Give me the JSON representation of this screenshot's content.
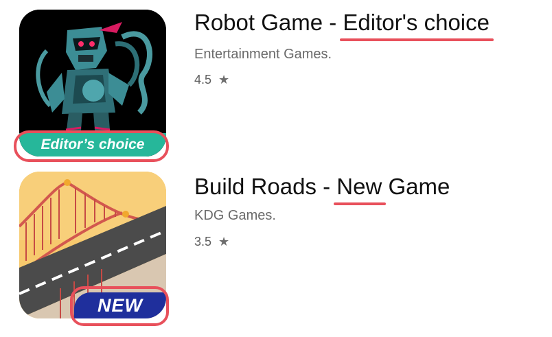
{
  "apps": [
    {
      "title_prefix": "Robot Game - ",
      "title_highlight": "Editor's choice",
      "title_suffix": "",
      "developer": "Entertainment Games.",
      "rating": "4.5",
      "badge": "Editor’s choice",
      "badge_color": "#26b79a",
      "icon": "robot-ninja-icon"
    },
    {
      "title_prefix": "Build Roads - ",
      "title_highlight": "New",
      "title_suffix": " Game",
      "developer": "KDG Games.",
      "rating": "3.5",
      "badge": "NEW",
      "badge_color": "#1f2f9c",
      "icon": "bridge-road-icon"
    }
  ],
  "star_glyph": "★",
  "highlight_color": "#e8505b"
}
